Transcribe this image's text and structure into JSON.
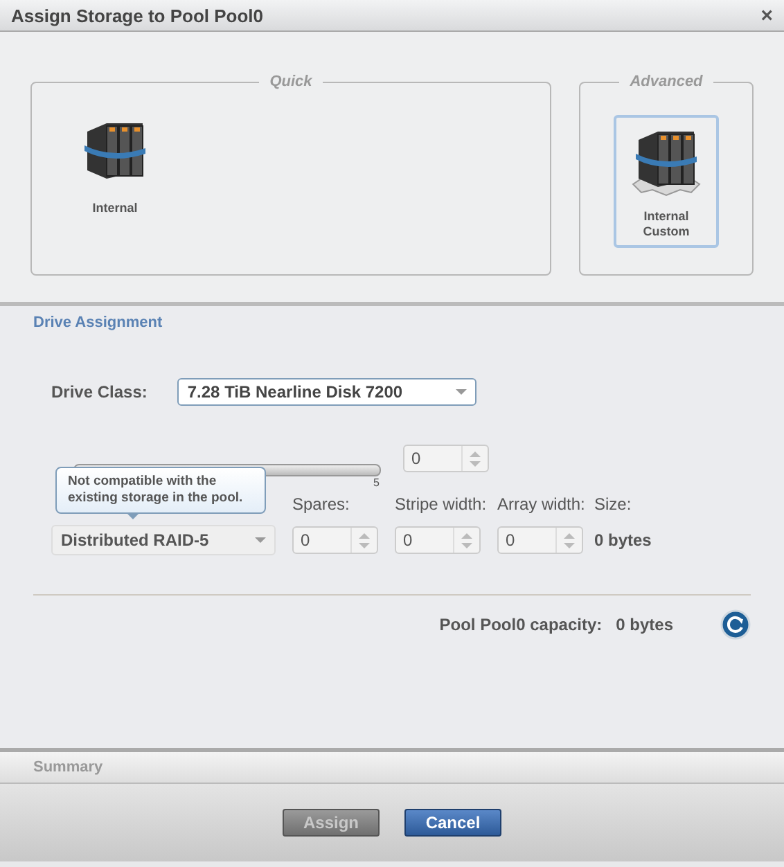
{
  "window": {
    "title": "Assign Storage to Pool Pool0",
    "close": "×"
  },
  "groups": [
    {
      "legend": "Quick",
      "options": [
        {
          "label": "Internal",
          "selected": false
        }
      ]
    },
    {
      "legend": "Advanced",
      "options": [
        {
          "label": "Internal\nCustom",
          "selected": true
        }
      ]
    }
  ],
  "drive_assignment": {
    "heading": "Drive Assignment",
    "drive_class": {
      "label": "Drive Class:",
      "value": "7.28 TiB Nearline Disk 7200"
    },
    "drive_count": {
      "max_label": "5",
      "value": "0",
      "disabled": true
    },
    "tooltip": "Not compatible with the existing storage in the pool.",
    "raid": {
      "value": "Distributed RAID-5",
      "disabled": true
    },
    "spares": {
      "label": "Spares:",
      "value": "0",
      "disabled": true
    },
    "stripe_width": {
      "label": "Stripe width:",
      "value": "0",
      "disabled": true
    },
    "array_width": {
      "label": "Array width:",
      "value": "0",
      "disabled": true
    },
    "size": {
      "label": "Size:",
      "value": "0 bytes"
    },
    "capacity": {
      "label": "Pool Pool0 capacity:",
      "value": "0 bytes"
    }
  },
  "summary": {
    "heading": "Summary"
  },
  "buttons": [
    {
      "label": "Assign",
      "kind": "secondary",
      "disabled": true
    },
    {
      "label": "Cancel",
      "kind": "primary",
      "disabled": false
    }
  ]
}
